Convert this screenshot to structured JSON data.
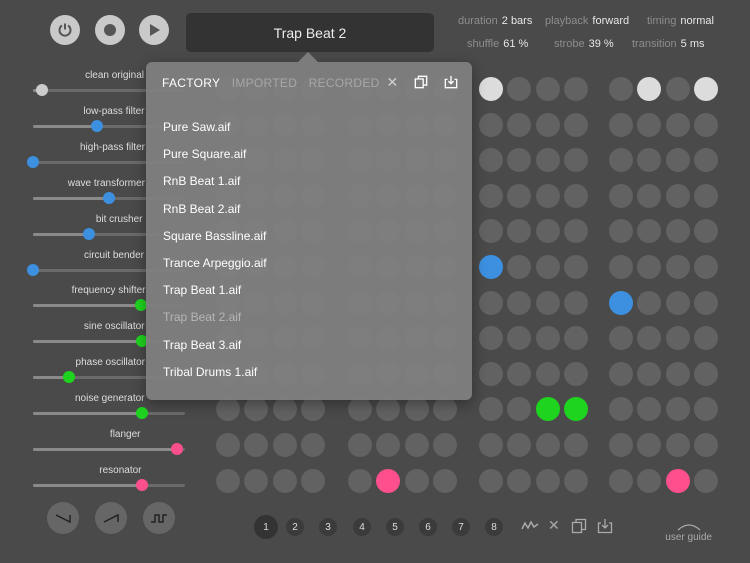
{
  "header": {
    "title": "Trap Beat 2",
    "params": [
      {
        "key": "duration",
        "value": "2 bars"
      },
      {
        "key": "playback",
        "value": "forward"
      },
      {
        "key": "timing",
        "value": "normal"
      },
      {
        "key": "shuffle",
        "value": "61 %"
      },
      {
        "key": "strobe",
        "value": "39 %"
      },
      {
        "key": "transition",
        "value": "5 ms"
      }
    ]
  },
  "effects": [
    {
      "label": "clean original",
      "value": 0.06,
      "color": "#cccccc"
    },
    {
      "label": "low-pass filter",
      "value": 0.42,
      "color": "#3d8fe0"
    },
    {
      "label": "high-pass filter",
      "value": 0.0,
      "color": "#3d8fe0"
    },
    {
      "label": "wave transformer",
      "value": 0.5,
      "color": "#3d8fe0"
    },
    {
      "label": "bit crusher",
      "value": 0.37,
      "color": "#3d8fe0"
    },
    {
      "label": "circuit bender",
      "value": 0.0,
      "color": "#3d8fe0"
    },
    {
      "label": "frequency shifter",
      "value": 0.71,
      "color": "#1fd41f"
    },
    {
      "label": "sine oscillator",
      "value": 0.72,
      "color": "#1fd41f"
    },
    {
      "label": "phase oscillator",
      "value": 0.24,
      "color": "#1fd41f"
    },
    {
      "label": "noise generator",
      "value": 0.72,
      "color": "#1fd41f"
    },
    {
      "label": "flanger",
      "value": 0.95,
      "color": "#ff4f8c"
    },
    {
      "label": "resonator",
      "value": 0.72,
      "color": "#ff4f8c"
    }
  ],
  "browser": {
    "tabs": [
      "FACTORY",
      "IMPORTED",
      "RECORDED"
    ],
    "active_tab": "FACTORY",
    "files": [
      "Pure Saw.aif",
      "Pure Square.aif",
      "RnB Beat 1.aif",
      "RnB Beat 2.aif",
      "Square Bassline.aif",
      "Trance Arpeggio.aif",
      "Trap Beat 1.aif",
      "Trap Beat 2.aif",
      "Trap Beat 3.aif",
      "Tribal Drums 1.aif"
    ],
    "selected_file": "Trap Beat 2.aif"
  },
  "pages": [
    "1",
    "2",
    "3",
    "4",
    "5",
    "6",
    "7",
    "8"
  ],
  "selected_page": "1",
  "user_guide": "user guide",
  "colors": {
    "blue": "#3d8fe0",
    "green": "#1fd41f",
    "pink": "#ff4f8c",
    "white": "#dcdcdc",
    "pad": "#626262"
  },
  "grid_active": [
    {
      "col": 8,
      "row": 0,
      "color": "white"
    },
    {
      "col": 13,
      "row": 0,
      "color": "white"
    },
    {
      "col": 15,
      "row": 0,
      "color": "white"
    },
    {
      "col": 8,
      "row": 5,
      "color": "blue"
    },
    {
      "col": 12,
      "row": 6,
      "color": "blue"
    },
    {
      "col": 10,
      "row": 9,
      "color": "green"
    },
    {
      "col": 11,
      "row": 9,
      "color": "green"
    },
    {
      "col": 5,
      "row": 11,
      "color": "pink"
    },
    {
      "col": 14,
      "row": 11,
      "color": "pink"
    }
  ]
}
